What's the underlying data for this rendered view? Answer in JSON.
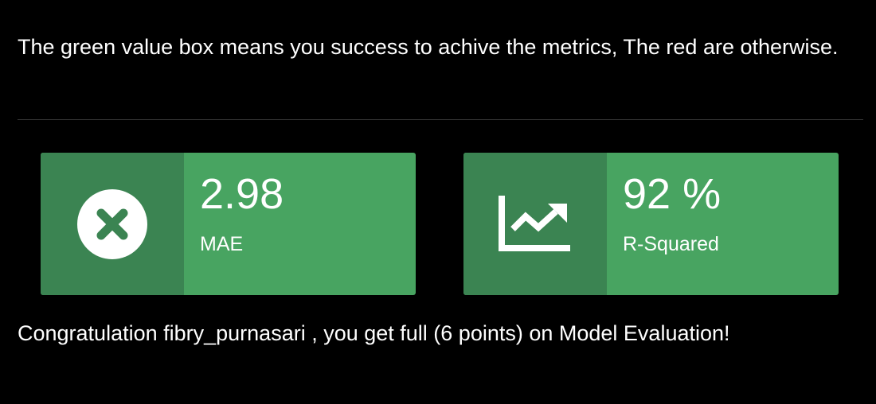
{
  "intro_text": "The green value box means you success to achive the metrics, The red are otherwise.",
  "colors": {
    "background": "#000000",
    "box_green": "#48a461",
    "box_green_dark": "#3b8452",
    "text": "#ffffff"
  },
  "metrics": [
    {
      "value": "2.98",
      "label": "MAE",
      "icon": "times-circle-icon",
      "status": "success"
    },
    {
      "value": "92 %",
      "label": "R-Squared",
      "icon": "line-chart-icon",
      "status": "success"
    }
  ],
  "congrats_text": "Congratulation fibry_purnasari , you get full (6 points) on Model Evaluation!"
}
